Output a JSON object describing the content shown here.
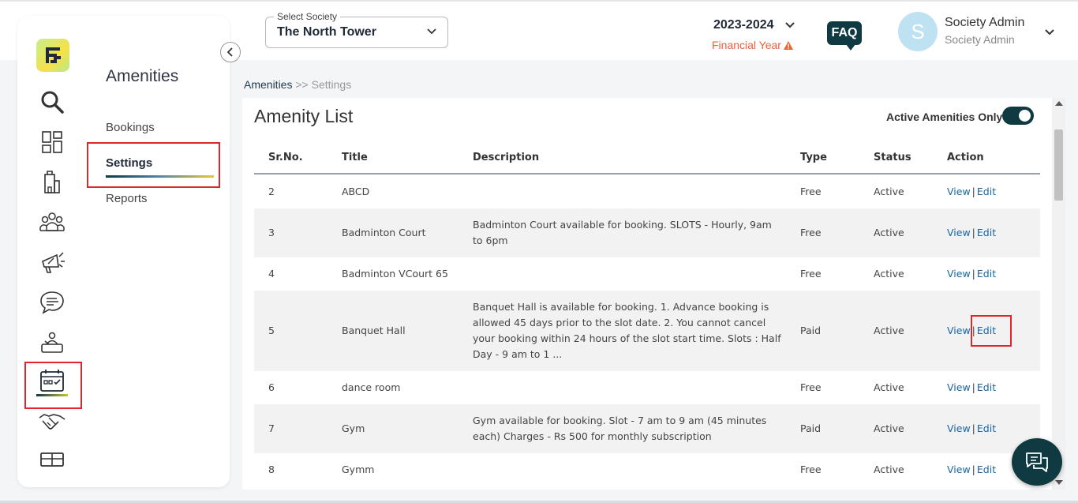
{
  "header": {
    "society_label": "Select Society",
    "society_value": "The North Tower",
    "financial_year": "2023-2024",
    "financial_year_label": "Financial Year",
    "faq_label": "FAQ",
    "avatar_initial": "S",
    "user_name": "Society Admin",
    "user_role": "Society Admin"
  },
  "sidebar": {
    "section_title": "Amenities",
    "items": [
      {
        "label": "Bookings"
      },
      {
        "label": "Settings"
      },
      {
        "label": "Reports"
      }
    ],
    "nav_icons": [
      "search-icon",
      "dashboard-icon",
      "building-icon",
      "members-icon",
      "announcement-icon",
      "chat-icon",
      "helpdesk-icon",
      "calendar-icon",
      "handshake-icon",
      "package-icon"
    ]
  },
  "breadcrumb": {
    "parent": "Amenities",
    "separator": ">>",
    "current": "Settings"
  },
  "main": {
    "title": "Amenity List",
    "toggle_label": "Active Amenities Only",
    "toggle_on": true,
    "columns": [
      "Sr.No.",
      "Title",
      "Description",
      "Type",
      "Status",
      "Action"
    ],
    "view_label": "View",
    "edit_label": "Edit",
    "rows": [
      {
        "sr": "2",
        "title": "ABCD",
        "description": "",
        "type": "Free",
        "status": "Active"
      },
      {
        "sr": "3",
        "title": "Badminton Court",
        "description": "Badminton Court available for booking. SLOTS - Hourly, 9am to 6pm",
        "type": "Free",
        "status": "Active"
      },
      {
        "sr": "4",
        "title": "Badminton VCourt 65",
        "description": "",
        "type": "Free",
        "status": "Active"
      },
      {
        "sr": "5",
        "title": "Banquet Hall",
        "description": "Banquet Hall is available for booking.  1. Advance booking is allowed 45 days prior to the slot date. 2. You cannot cancel your booking within 24 hours of the slot start time. Slots :  Half Day - 9 am to 1 ...",
        "type": "Paid",
        "status": "Active"
      },
      {
        "sr": "6",
        "title": "dance room",
        "description": "",
        "type": "Free",
        "status": "Active"
      },
      {
        "sr": "7",
        "title": "Gym",
        "description": "Gym available for booking. Slot - 7 am to 9 am (45 minutes each) Charges - Rs 500 for monthly subscription",
        "type": "Paid",
        "status": "Active"
      },
      {
        "sr": "8",
        "title": "Gymm",
        "description": "",
        "type": "Free",
        "status": "Active"
      }
    ]
  },
  "colors": {
    "primary": "#0f3a42",
    "link": "#1565a8",
    "warning": "#e8623a",
    "highlight": "#e0262b"
  }
}
